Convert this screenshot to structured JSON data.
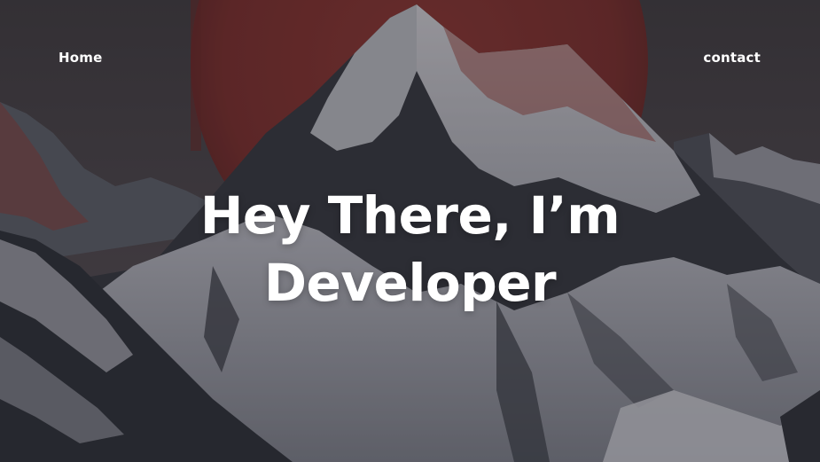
{
  "nav": {
    "home_label": "Home",
    "contact_label": "contact"
  },
  "hero": {
    "headline_line1": "Hey There, I’m",
    "headline_line2": "Developer"
  },
  "colors": {
    "sky": "#4a4347",
    "sun": "#7a2e2b",
    "snow": "#d8d7dc",
    "rock": "#2f3036",
    "text": "#ffffff"
  }
}
